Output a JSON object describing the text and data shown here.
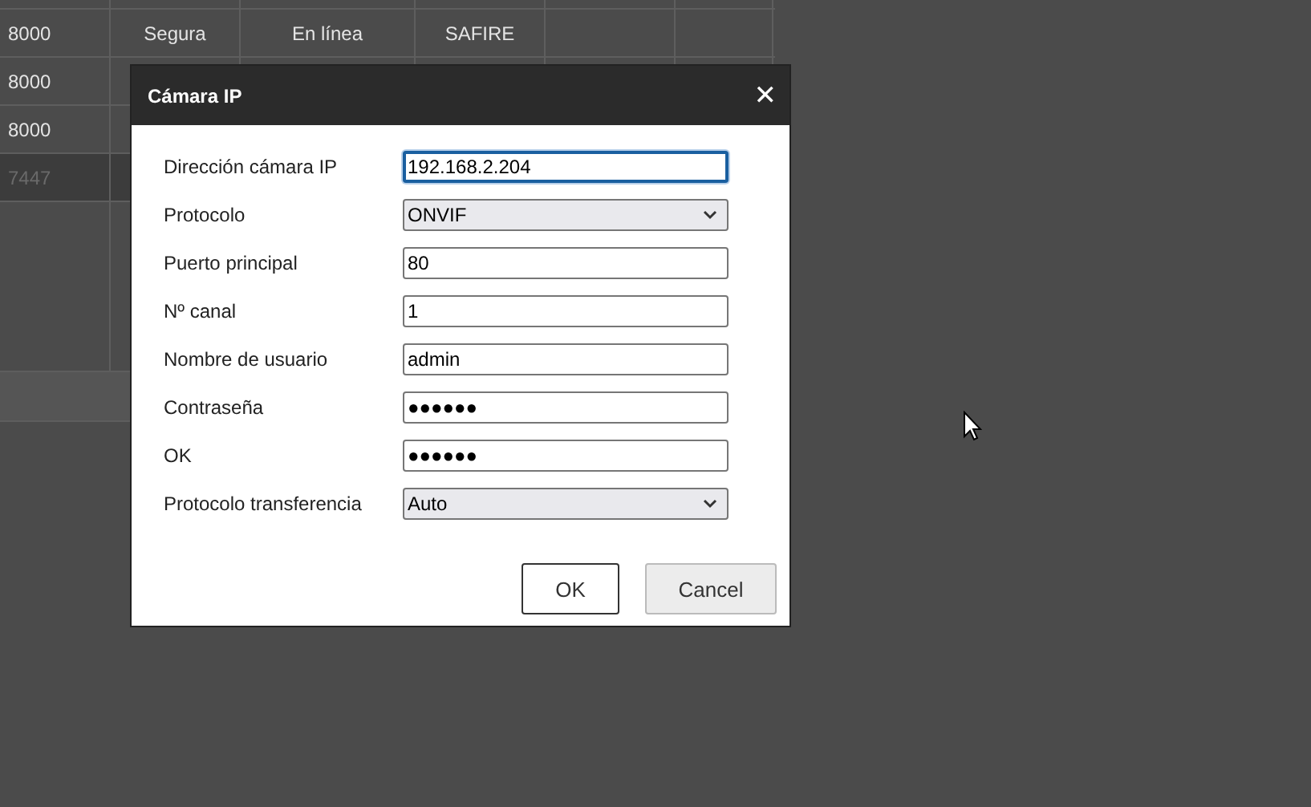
{
  "background_table": {
    "rows": [
      {
        "cells": [
          "8000",
          "Segura",
          "En línea",
          "SAFIRE"
        ],
        "selected": false
      },
      {
        "cells": [
          "8000"
        ],
        "selected": false
      },
      {
        "cells": [
          "8000"
        ],
        "selected": false
      },
      {
        "cells": [
          "7447"
        ],
        "selected": true
      }
    ]
  },
  "dialog": {
    "title": "Cámara IP",
    "close": "✕",
    "fields": [
      {
        "label": "Dirección cámara IP",
        "kind": "text",
        "value": "192.168.2.204",
        "focused": true
      },
      {
        "label": "Protocolo",
        "kind": "select",
        "value": "ONVIF",
        "focused": false
      },
      {
        "label": "Puerto principal",
        "kind": "text",
        "value": "80",
        "focused": false
      },
      {
        "label": "Nº canal",
        "kind": "text",
        "value": "1",
        "focused": false
      },
      {
        "label": "Nombre de usuario",
        "kind": "text",
        "value": "admin",
        "focused": false
      },
      {
        "label": "Contraseña",
        "kind": "text",
        "value": "●●●●●●",
        "focused": false
      },
      {
        "label": "OK",
        "kind": "text",
        "value": "●●●●●●",
        "focused": false
      },
      {
        "label": "Protocolo transferencia",
        "kind": "select",
        "value": "Auto",
        "focused": false
      }
    ],
    "buttons": [
      {
        "label": "OK",
        "kind": "primary"
      },
      {
        "label": "Cancel",
        "kind": "secondary"
      }
    ]
  }
}
